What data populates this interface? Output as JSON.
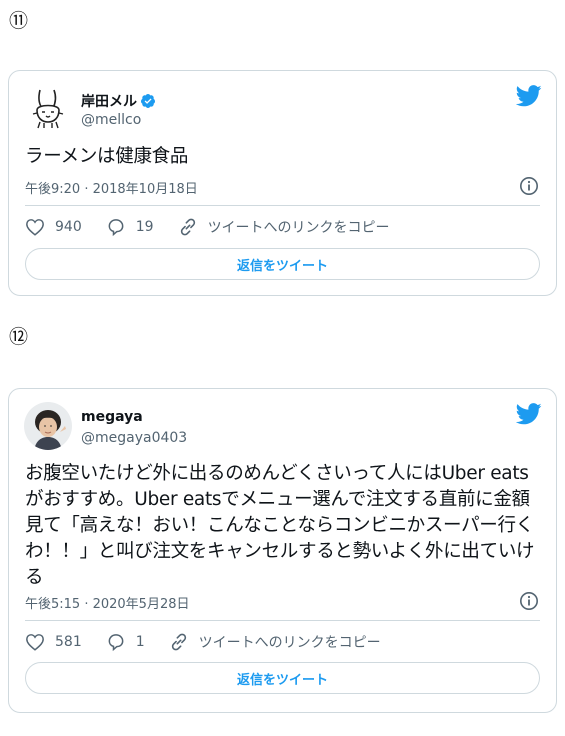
{
  "sections": [
    {
      "number": "⑪",
      "tweet": {
        "display_name": "岸田メル",
        "verified": true,
        "handle": "@mellco",
        "text": "ラーメンは健康食品",
        "timestamp": "午後9:20 · 2018年10月18日",
        "likes": "940",
        "replies": "19",
        "copy_link_label": "ツイートへのリンクをコピー",
        "reply_button_label": "返信をツイート"
      }
    },
    {
      "number": "⑫",
      "tweet": {
        "display_name": "megaya",
        "verified": false,
        "handle": "@megaya0403",
        "text": "お腹空いたけど外に出るのめんどくさいって人にはUber eatsがおすすめ。Uber eatsでメニュー選んで注文する直前に金額見て「高えな！おい！こんなことならコンビニかスーパー行くわ！！」と叫び注文をキャンセルすると勢いよく外に出ていける",
        "timestamp": "午後5:15 · 2020年5月28日",
        "likes": "581",
        "replies": "1",
        "copy_link_label": "ツイートへのリンクをコピー",
        "reply_button_label": "返信をツイート"
      }
    }
  ],
  "colors": {
    "accent": "#1d9bf0",
    "text_primary": "#0f1419",
    "text_secondary": "#536471",
    "border": "#cfd9de"
  },
  "icons": [
    "twitter-bird-icon",
    "verified-badge-icon",
    "info-icon",
    "heart-icon",
    "reply-icon",
    "link-icon"
  ]
}
